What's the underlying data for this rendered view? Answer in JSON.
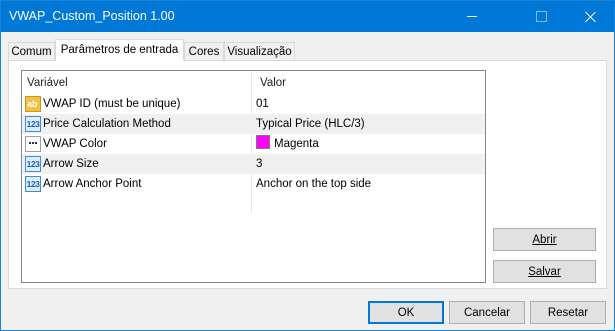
{
  "window": {
    "title": "VWAP_Custom_Position 1.00",
    "accent_color": "#0078d7"
  },
  "tabs": [
    {
      "label": "Comum"
    },
    {
      "label": "Parâmetros de entrada",
      "active": true
    },
    {
      "label": "Cores"
    },
    {
      "label": "Visualização"
    }
  ],
  "table": {
    "headers": {
      "variable": "Variável",
      "value": "Valor"
    },
    "rows": [
      {
        "icon": "string-ab-icon",
        "name": "VWAP ID  (must be unique)",
        "value": "01"
      },
      {
        "icon": "number-123-icon",
        "name": "Price Calculation Method",
        "value": "Typical Price (HLC/3)"
      },
      {
        "icon": "color-palette-icon",
        "name": "VWAP Color",
        "value": "Magenta",
        "swatch_color": "#ff00ff"
      },
      {
        "icon": "number-123-icon",
        "name": "Arrow Size",
        "value": "3"
      },
      {
        "icon": "number-123-icon",
        "name": "Arrow Anchor Point",
        "value": "Anchor on the top side"
      }
    ]
  },
  "side_buttons": {
    "open_label": "Abrir",
    "save_label": "Salvar"
  },
  "footer": {
    "ok_label": "OK",
    "cancel_label": "Cancelar",
    "reset_label": "Resetar"
  }
}
